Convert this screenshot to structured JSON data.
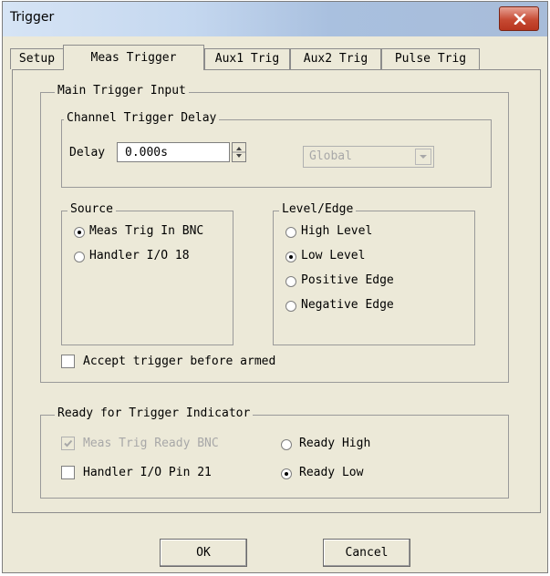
{
  "window": {
    "title": "Trigger",
    "close_icon": "close-icon"
  },
  "tabs": [
    {
      "label": "Setup",
      "active": false
    },
    {
      "label": "Meas Trigger",
      "active": true
    },
    {
      "label": "Aux1 Trig",
      "active": false
    },
    {
      "label": "Aux2 Trig",
      "active": false
    },
    {
      "label": "Pulse Trig",
      "active": false
    }
  ],
  "main_input": {
    "legend": "Main Trigger Input",
    "delay_group": {
      "legend": "Channel Trigger Delay",
      "delay_label": "Delay",
      "delay_value": "0.000s",
      "scope_value": "Global",
      "scope_enabled": false
    },
    "source": {
      "legend": "Source",
      "options": [
        {
          "label": "Meas Trig In BNC",
          "selected": true
        },
        {
          "label": "Handler I/O 18",
          "selected": false
        }
      ]
    },
    "level_edge": {
      "legend": "Level/Edge",
      "options": [
        {
          "label": "High Level",
          "selected": false
        },
        {
          "label": "Low Level",
          "selected": true
        },
        {
          "label": "Positive Edge",
          "selected": false
        },
        {
          "label": "Negative Edge",
          "selected": false
        }
      ]
    },
    "accept_before_armed": {
      "label": "Accept trigger before armed",
      "checked": false
    }
  },
  "ready_indicator": {
    "legend": "Ready for Trigger Indicator",
    "meas_trig_ready_bnc": {
      "label": "Meas Trig Ready BNC",
      "checked": true,
      "enabled": false
    },
    "handler_pin21": {
      "label": "Handler I/O Pin 21",
      "checked": false
    },
    "ready_high": {
      "label": "Ready High",
      "selected": false
    },
    "ready_low": {
      "label": "Ready Low",
      "selected": true
    }
  },
  "buttons": {
    "ok": "OK",
    "cancel": "Cancel"
  }
}
